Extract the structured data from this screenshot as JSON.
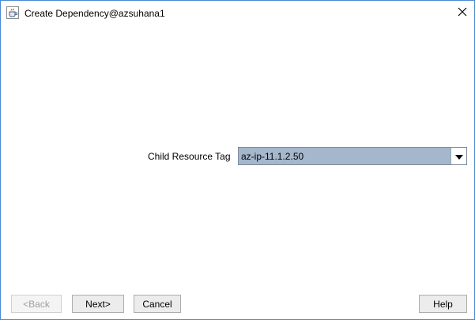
{
  "window": {
    "title": "Create Dependency@azsuhana1",
    "icons": {
      "app": "java-cup-icon",
      "close": "close-icon"
    }
  },
  "form": {
    "child_resource_tag_label": "Child Resource Tag",
    "child_resource_tag_value": "az-ip-11.1.2.50",
    "dropdown_icon": "triangle-down-icon"
  },
  "buttons": {
    "back": "<Back",
    "next": "Next>",
    "cancel": "Cancel",
    "help": "Help"
  },
  "colors": {
    "combo_selected_bg": "#a5b7cc",
    "window_border": "#4a8ad4",
    "disabled_text": "#a0a0a0"
  }
}
